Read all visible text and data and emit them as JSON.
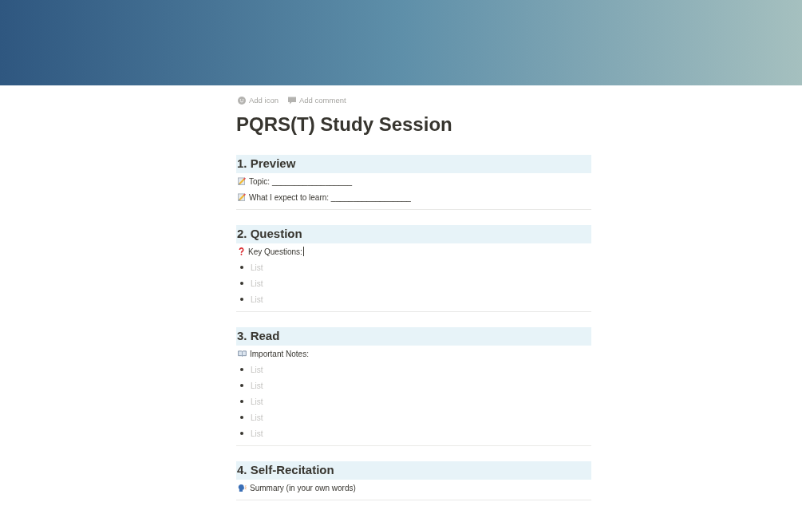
{
  "page_actions": [
    {
      "kind": "icon",
      "label": "Add icon"
    },
    {
      "kind": "comment",
      "label": "Add comment"
    }
  ],
  "title": "PQRS(T) Study Session",
  "sections": [
    {
      "heading": "1. Preview",
      "lines": [
        {
          "text": "Topic: __________________",
          "focused": false
        },
        {
          "text": "What I expect to learn: __________________",
          "focused": false
        }
      ]
    },
    {
      "heading": "2. Question",
      "lines": [
        {
          "text": "Key Questions:",
          "focused": true
        }
      ],
      "bullets": [
        {
          "placeholder": "List"
        },
        {
          "placeholder": "List"
        },
        {
          "placeholder": "List"
        }
      ]
    },
    {
      "heading": "3. Read",
      "lines": [
        {
          "text": "Important Notes:",
          "focused": false
        }
      ],
      "bullets": [
        {
          "placeholder": "List"
        },
        {
          "placeholder": "List"
        },
        {
          "placeholder": "List"
        },
        {
          "placeholder": "List"
        },
        {
          "placeholder": "List"
        }
      ]
    },
    {
      "heading": "4. Self-Recitation",
      "lines": [
        {
          "text": "Summary (in your own words)",
          "focused": false
        }
      ]
    }
  ]
}
